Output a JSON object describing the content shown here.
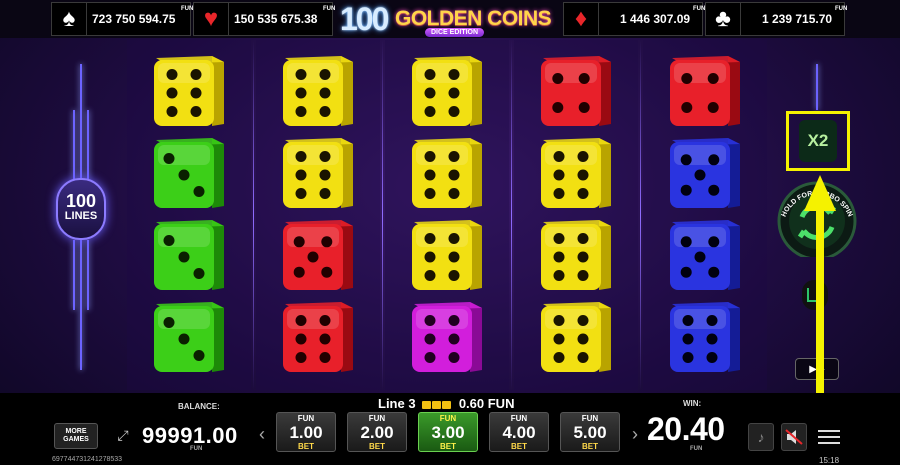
{
  "jackpots": [
    {
      "suit": "♠",
      "color": "#ffffff",
      "value": "723 750 594.75",
      "currency": "FUN"
    },
    {
      "suit": "♥",
      "color": "#e8262a",
      "value": "150 535 675.38",
      "currency": "FUN"
    },
    {
      "suit": "♦",
      "color": "#e8262a",
      "value": "1 446 307.09",
      "currency": "FUN"
    },
    {
      "suit": "♣",
      "color": "#ffffff",
      "value": "1 239 715.70",
      "currency": "FUN"
    }
  ],
  "logo": {
    "number": "100",
    "title": "GOLDEN COINS",
    "edition": "DICE EDITION"
  },
  "lines": {
    "count": "100",
    "label": "LINES"
  },
  "multiplier": {
    "label": "X2"
  },
  "spin_button": {
    "label": "HOLD FOR TURBO SPIN"
  },
  "reels": [
    [
      {
        "color": "yellow",
        "pips": 6
      },
      {
        "color": "green",
        "pips": 3
      },
      {
        "color": "green",
        "pips": 3
      },
      {
        "color": "green",
        "pips": 3
      }
    ],
    [
      {
        "color": "yellow",
        "pips": 6
      },
      {
        "color": "yellow",
        "pips": 6
      },
      {
        "color": "red",
        "pips": 5
      },
      {
        "color": "red",
        "pips": 6
      }
    ],
    [
      {
        "color": "yellow",
        "pips": 6
      },
      {
        "color": "yellow",
        "pips": 6
      },
      {
        "color": "yellow",
        "pips": 6
      },
      {
        "color": "purple",
        "pips": 6
      }
    ],
    [
      {
        "color": "red",
        "pips": 4
      },
      {
        "color": "yellow",
        "pips": 6
      },
      {
        "color": "yellow",
        "pips": 6
      },
      {
        "color": "yellow",
        "pips": 6
      }
    ],
    [
      {
        "color": "red",
        "pips": 4
      },
      {
        "color": "blue",
        "pips": 5
      },
      {
        "color": "blue",
        "pips": 5
      },
      {
        "color": "blue",
        "pips": 6
      }
    ]
  ],
  "die_colors": {
    "yellow": {
      "face": "#f2e012",
      "dark": "#b9a400",
      "pip": "#1a1400"
    },
    "green": {
      "face": "#3ccf18",
      "dark": "#1d8a08",
      "pip": "#0a2000"
    },
    "red": {
      "face": "#e8202a",
      "dark": "#9a0a12",
      "pip": "#200000"
    },
    "purple": {
      "face": "#d21edc",
      "dark": "#8a0a96",
      "pip": "#200020"
    },
    "blue": {
      "face": "#2a34e0",
      "dark": "#141c96",
      "pip": "#000010"
    }
  },
  "bottom": {
    "more_games": "MORE GAMES",
    "balance_label": "BALANCE:",
    "balance": "99991.00",
    "balance_currency": "FUN",
    "line_info": {
      "prefix": "Line 3",
      "amount": "0.60 FUN"
    },
    "bets": [
      {
        "currency": "FUN",
        "amount": "1.00",
        "label": "BET",
        "selected": false
      },
      {
        "currency": "FUN",
        "amount": "2.00",
        "label": "BET",
        "selected": false
      },
      {
        "currency": "FUN",
        "amount": "3.00",
        "label": "BET",
        "selected": true
      },
      {
        "currency": "FUN",
        "amount": "4.00",
        "label": "BET",
        "selected": false
      },
      {
        "currency": "FUN",
        "amount": "5.00",
        "label": "BET",
        "selected": false
      }
    ],
    "win_label": "WIN:",
    "win": "20.40",
    "win_currency": "FUN",
    "session_id": "697744731241278533",
    "clock": "15:18"
  },
  "accent": {
    "highlight": "#f5f200",
    "selected_bet": "#3a9a2a",
    "neon": "#6c63ff"
  },
  "icons": {
    "sound": "music-note-icon",
    "mute": "speaker-muted-icon",
    "menu": "hamburger-icon",
    "fullscreen": "fullscreen-icon",
    "autoplay": "autoplay-icon"
  }
}
